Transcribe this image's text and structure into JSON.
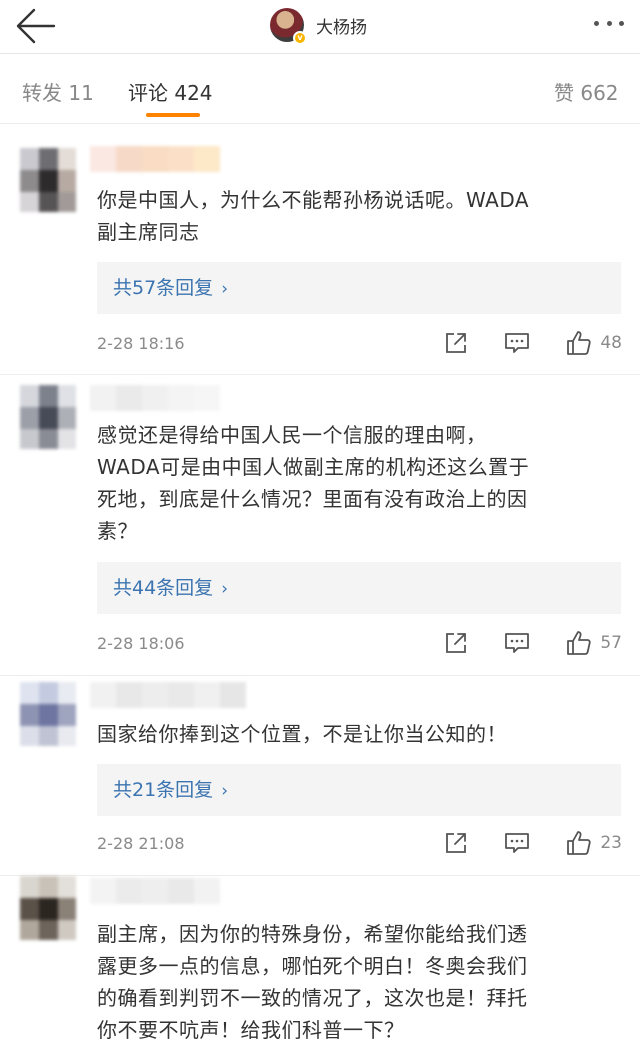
{
  "header": {
    "author_name": "大杨扬",
    "back_icon": "arrow-left-icon",
    "more_icon": "more-dots-icon"
  },
  "tabs": {
    "repost_label": "转发 11",
    "comment_label": "评论 424",
    "like_label": "赞 662"
  },
  "colors": {
    "accent": "#ff8200",
    "link": "#3b74b0",
    "meta": "#8a8a8a"
  },
  "comments": [
    {
      "text_lines": [
        "你是中国人，为什么不能帮孙杨说话呢。WADA",
        "副主席同志"
      ],
      "replies": "共57条回复",
      "time": "2-28 18:16",
      "likes": "48"
    },
    {
      "text_lines": [
        "感觉还是得给中国人民一个信服的理由啊，",
        "WADA可是由中国人做副主席的机构还这么置于",
        "死地，到底是什么情况？里面有没有政治上的因",
        "素？"
      ],
      "replies": "共44条回复",
      "time": "2-28 18:06",
      "likes": "57"
    },
    {
      "text_lines": [
        "国家给你捧到这个位置，不是让你当公知的！"
      ],
      "replies": "共21条回复",
      "time": "2-28 21:08",
      "likes": "23"
    },
    {
      "text_lines": [
        "副主席，因为你的特殊身份，希望你能给我们透",
        "露更多一点的信息，哪怕死个明白！冬奥会我们",
        "的确看到判罚不一致的情况了，这次也是！拜托",
        "你不要不吭声！给我们科普一下？"
      ]
    }
  ],
  "reply_chevron": "›"
}
